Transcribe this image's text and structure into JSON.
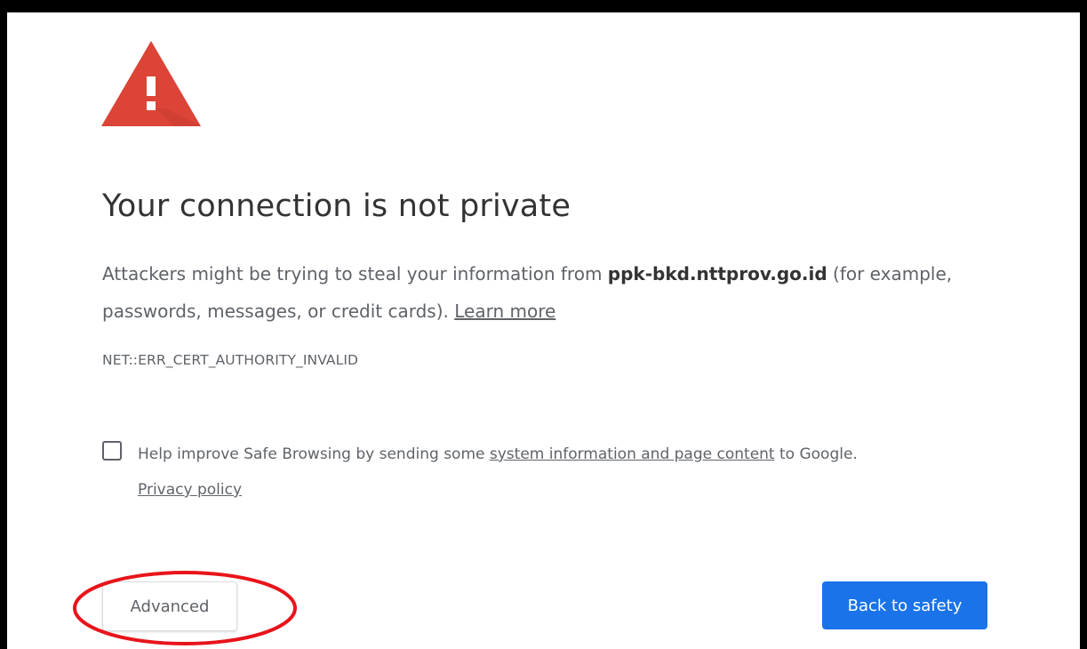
{
  "page": {
    "heading": "Your connection is not private",
    "explanation": {
      "prefix": "Attackers might be trying to steal your information from ",
      "host": "ppk-bkd.nttprov.go.id",
      "suffix": " (for example, passwords, messages, or credit cards). ",
      "learn_more": "Learn more"
    },
    "error_code": "NET::ERR_CERT_AUTHORITY_INVALID",
    "safe_browsing": {
      "prefix": "Help improve Safe Browsing by sending some ",
      "link": "system information and page content",
      "suffix": " to Google.",
      "privacy_link": "Privacy policy",
      "checked": false
    },
    "buttons": {
      "advanced": "Advanced",
      "back_to_safety": "Back to safety"
    }
  },
  "colors": {
    "warning_red": "#db4437",
    "primary_blue": "#1a73e8",
    "annotation_red": "#e8141b",
    "heading_text": "#333333",
    "body_text": "#5f6368"
  },
  "icons": {
    "warning": "warning-triangle-icon"
  }
}
